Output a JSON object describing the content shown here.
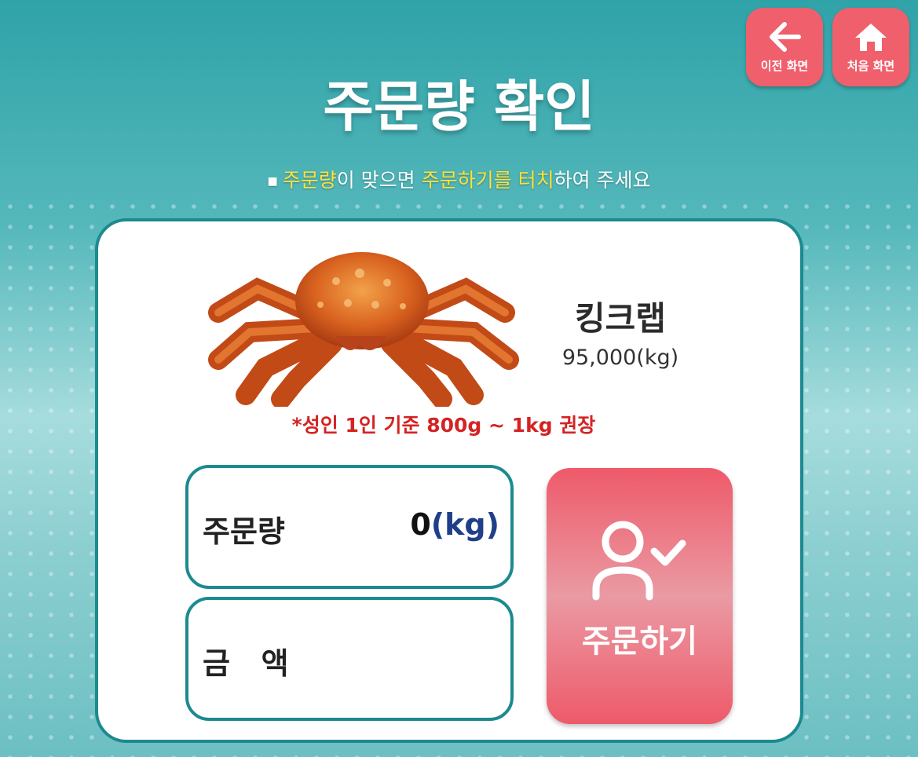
{
  "nav": {
    "back_label": "이전 화면",
    "home_label": "처음 화면"
  },
  "header": {
    "title": "주문량 확인",
    "subtitle_parts": [
      "주문량",
      "이 맞으면 ",
      "주문하기를",
      " ",
      "터치",
      "하여 주세요"
    ]
  },
  "product": {
    "name": "킹크랩",
    "price": "95,000(kg)",
    "note": "*성인 1인 기준 800g ~ 1kg 권장"
  },
  "order": {
    "quantity_label": "주문량",
    "quantity_value": "0",
    "quantity_unit": "(kg)",
    "amount_label": "금   액",
    "amount_value": ""
  },
  "actions": {
    "order_label": "주문하기"
  },
  "colors": {
    "accent_pink": "#ef5f6c",
    "frame_teal": "#1c8a90",
    "highlight_yellow": "#ffe23a",
    "note_red": "#d42323"
  }
}
